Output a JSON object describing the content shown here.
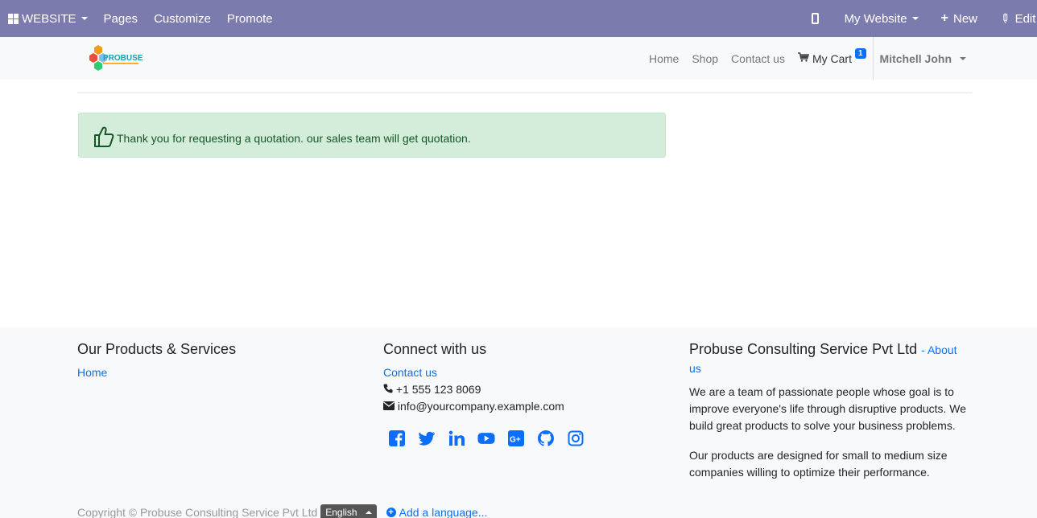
{
  "adminbar": {
    "website_label": "WEBSITE",
    "pages_label": "Pages",
    "customize_label": "Customize",
    "promote_label": "Promote",
    "my_website_label": "My Website",
    "new_label": "New",
    "edit_label": "Edit"
  },
  "nav": {
    "logo_text": "PROBUSE",
    "home": "Home",
    "shop": "Shop",
    "contact": "Contact us",
    "cart": "My Cart",
    "cart_count": "1",
    "user": "Mitchell John"
  },
  "alert": {
    "message": "Thank you for requesting a quotation. our sales team will get quotation."
  },
  "footer": {
    "products_title": "Our Products & Services",
    "products_home": "Home",
    "connect_title": "Connect with us",
    "contact_link": "Contact us",
    "phone": "+1 555 123 8069",
    "email": "info@yourcompany.example.com",
    "company_title": "Probuse Consulting Service Pvt Ltd",
    "about_sep": "- ",
    "about_link": "About us",
    "para1": "We are a team of passionate people whose goal is to improve everyone's life through disruptive products. We build great products to solve your business problems.",
    "para2": "Our products are designed for small to medium size companies willing to optimize their performance.",
    "socials": [
      "facebook-icon",
      "twitter-icon",
      "linkedin-icon",
      "youtube-icon",
      "google-plus-icon",
      "github-icon",
      "instagram-icon"
    ]
  },
  "copyright": {
    "text": "Copyright © Probuse Consulting Service Pvt Ltd",
    "language": "English",
    "add_language": "Add a language..."
  },
  "colors": {
    "adminbar": "#7c7bad",
    "link": "#0d6efd",
    "alert_bg": "#d4eddb",
    "alert_text": "#155724"
  }
}
